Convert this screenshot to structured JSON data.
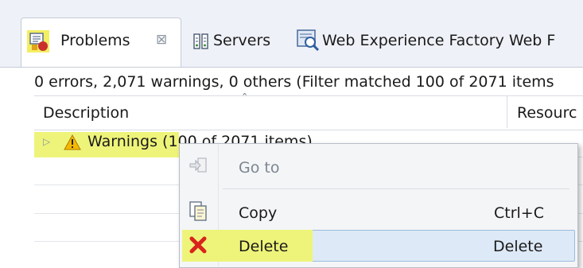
{
  "tabs": [
    {
      "label": "Problems",
      "active": true,
      "icon": "problems-icon",
      "close_glyph": "⊠"
    },
    {
      "label": "Servers",
      "active": false,
      "icon": "servers-icon"
    },
    {
      "label": "Web Experience Factory Web F",
      "active": false,
      "icon": "web-experience-icon"
    }
  ],
  "view": {
    "status": "0 errors, 2,071 warnings, 0 others (Filter matched 100 of 2071 items",
    "columns": {
      "description": "Description",
      "resource": "Resourc"
    },
    "sort_indicator": "⌃",
    "rows": [
      {
        "label": "Warnings (100 of 2071 items)",
        "severity_icon": "warning-icon",
        "expand_glyph": "▷"
      }
    ]
  },
  "context_menu": {
    "items": [
      {
        "label": "Go to",
        "shortcut": "",
        "icon": "goto-icon",
        "enabled": false
      },
      {
        "label": "Copy",
        "shortcut": "Ctrl+C",
        "icon": "copy-icon",
        "enabled": true
      },
      {
        "label": "Delete",
        "shortcut": "Delete",
        "icon": "delete-icon",
        "enabled": true,
        "hovered": true
      }
    ]
  },
  "colors": {
    "highlight": "#eef47a",
    "hover": "#dde9f6",
    "warning": "#f5b800",
    "delete": "#d9241c"
  }
}
